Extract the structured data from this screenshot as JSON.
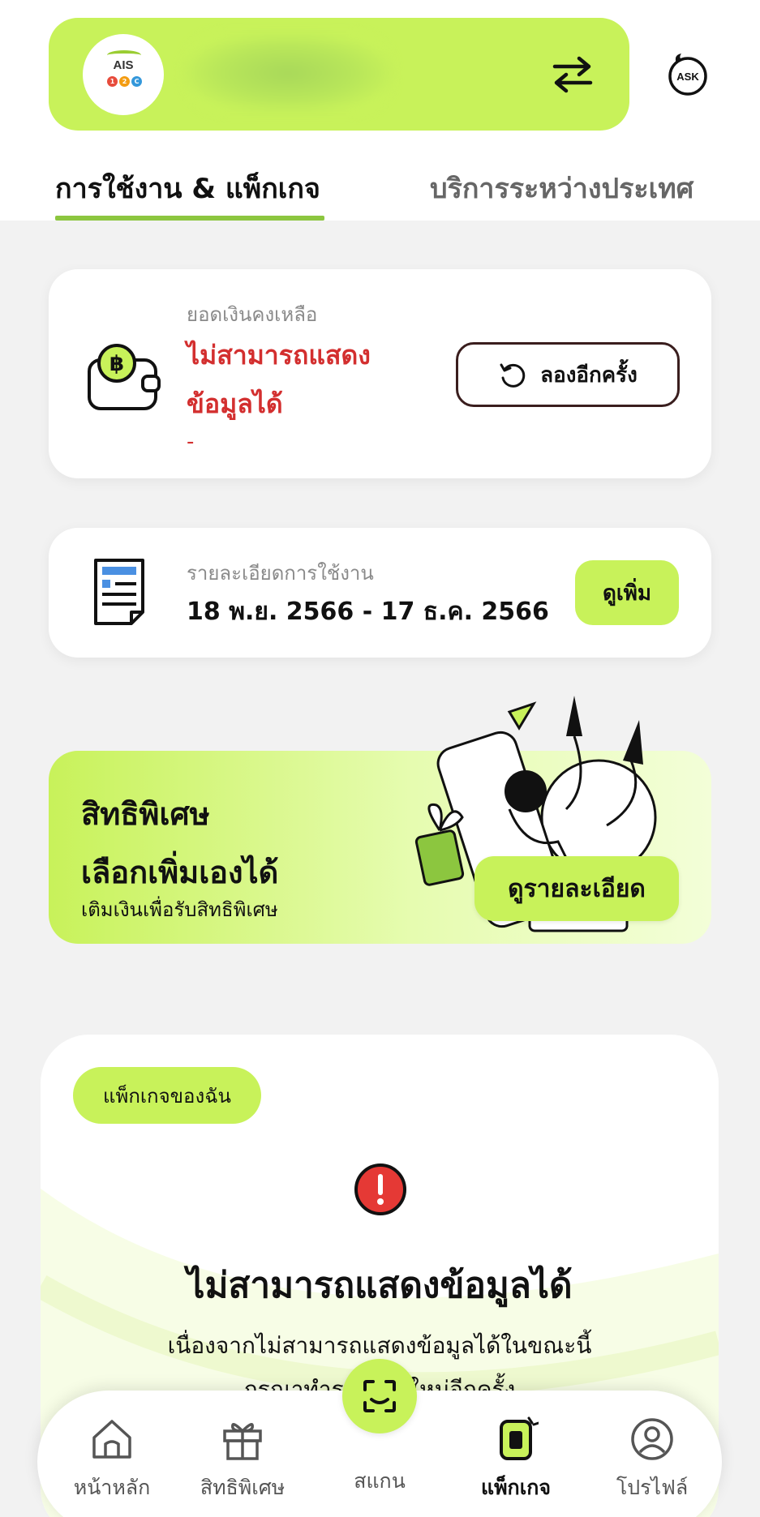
{
  "header": {
    "logo_text": "AIS",
    "logo_badge": [
      "1",
      "2",
      "C"
    ],
    "account_name": "",
    "switch_icon": "switch-arrows-icon",
    "ask_label": "ASK"
  },
  "tabs": [
    {
      "label": "การใช้งาน & แพ็กเกจ",
      "active": true
    },
    {
      "label": "บริการระหว่างประเทศ",
      "active": false
    }
  ],
  "balance": {
    "label": "ยอดเงินคงเหลือ",
    "error": "ไม่สามารถแสดงข้อมูลได้",
    "value": "-",
    "retry_label": "ลองอีกครั้ง"
  },
  "usage": {
    "label": "รายละเอียดการใช้งาน",
    "range": "18 พ.ย. 2566 - 17 ธ.ค. 2566",
    "more_label": "ดูเพิ่ม"
  },
  "promo": {
    "title_line1": "สิทธิพิเศษ",
    "title_line2": "เลือกเพิ่มเองได้",
    "subtitle": "เติมเงินเพื่อรับสิทธิพิเศษ",
    "button_label": "ดูรายละเอียด"
  },
  "packages": {
    "badge": "แพ็กเกจของฉัน",
    "error_title": "ไม่สามารถแสดงข้อมูลได้",
    "error_desc": "เนื่องจากไม่สามารถแสดงข้อมูลได้ในขณะนี้",
    "error_desc2": "กรุณาทำรายการใหม่อีกครั้ง"
  },
  "nav": {
    "items": [
      {
        "label": "หน้าหลัก",
        "icon": "home-icon"
      },
      {
        "label": "สิทธิพิเศษ",
        "icon": "gift-icon"
      },
      {
        "label": "สแกน",
        "icon": "scan-icon"
      },
      {
        "label": "แพ็กเกจ",
        "icon": "package-icon",
        "active": true
      },
      {
        "label": "โปรไฟล์",
        "icon": "profile-icon"
      }
    ]
  },
  "colors": {
    "accent": "#c8f25a",
    "active_underline": "#8cc63f",
    "error": "#d32f2f"
  }
}
